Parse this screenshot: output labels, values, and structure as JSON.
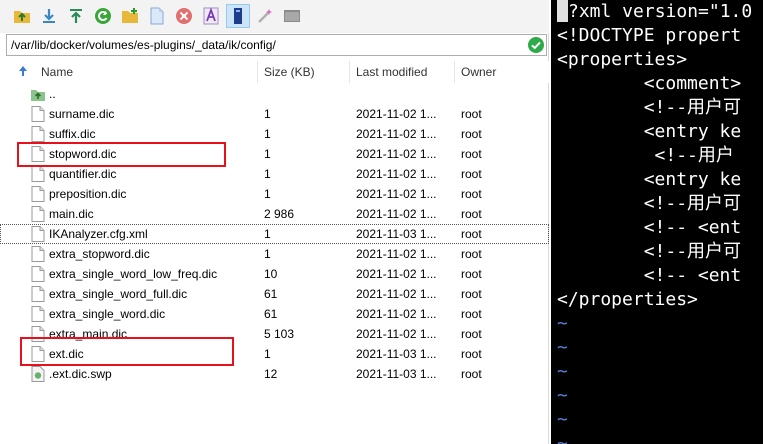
{
  "toolbar": {
    "buttons": [
      {
        "icon": "folder-up-icon"
      },
      {
        "icon": "download-icon"
      },
      {
        "icon": "upload-icon"
      },
      {
        "icon": "refresh-icon"
      },
      {
        "icon": "new-folder-icon"
      },
      {
        "icon": "new-file-icon"
      },
      {
        "icon": "delete-icon"
      },
      {
        "icon": "rename-icon"
      },
      {
        "icon": "properties-icon"
      },
      {
        "icon": "magic-wand-icon"
      },
      {
        "icon": "terminal-icon"
      }
    ]
  },
  "path_bar": {
    "path": "/var/lib/docker/volumes/es-plugins/_data/ik/config/"
  },
  "columns": {
    "name": "Name",
    "size": "Size (KB)",
    "modified": "Last modified",
    "owner": "Owner"
  },
  "files": [
    {
      "name": "..",
      "size": "",
      "modified": "",
      "owner": "",
      "icon": "parent-folder-icon"
    },
    {
      "name": "surname.dic",
      "size": "1",
      "modified": "2021-11-02 1...",
      "owner": "root",
      "icon": "file-icon"
    },
    {
      "name": "suffix.dic",
      "size": "1",
      "modified": "2021-11-02 1...",
      "owner": "root",
      "icon": "file-icon"
    },
    {
      "name": "stopword.dic",
      "size": "1",
      "modified": "2021-11-02 1...",
      "owner": "root",
      "icon": "file-icon"
    },
    {
      "name": "quantifier.dic",
      "size": "1",
      "modified": "2021-11-02 1...",
      "owner": "root",
      "icon": "file-icon"
    },
    {
      "name": "preposition.dic",
      "size": "1",
      "modified": "2021-11-02 1...",
      "owner": "root",
      "icon": "file-icon"
    },
    {
      "name": "main.dic",
      "size": "2 986",
      "modified": "2021-11-02 1...",
      "owner": "root",
      "icon": "file-icon"
    },
    {
      "name": "IKAnalyzer.cfg.xml",
      "size": "1",
      "modified": "2021-11-03 1...",
      "owner": "root",
      "icon": "file-icon"
    },
    {
      "name": "extra_stopword.dic",
      "size": "1",
      "modified": "2021-11-02 1...",
      "owner": "root",
      "icon": "file-icon"
    },
    {
      "name": "extra_single_word_low_freq.dic",
      "size": "10",
      "modified": "2021-11-02 1...",
      "owner": "root",
      "icon": "file-icon"
    },
    {
      "name": "extra_single_word_full.dic",
      "size": "61",
      "modified": "2021-11-02 1...",
      "owner": "root",
      "icon": "file-icon"
    },
    {
      "name": "extra_single_word.dic",
      "size": "61",
      "modified": "2021-11-02 1...",
      "owner": "root",
      "icon": "file-icon"
    },
    {
      "name": "extra_main.dic",
      "size": "5 103",
      "modified": "2021-11-02 1...",
      "owner": "root",
      "icon": "file-icon"
    },
    {
      "name": "ext.dic",
      "size": "1",
      "modified": "2021-11-03 1...",
      "owner": "root",
      "icon": "file-icon"
    },
    {
      "name": ".ext.dic.swp",
      "size": "12",
      "modified": "2021-11-03 1...",
      "owner": "root",
      "icon": "swap-file-icon"
    }
  ],
  "terminal": {
    "lines": [
      {
        "text": "?xml version=\"1.0",
        "color": "#ffffff"
      },
      {
        "text": "<!DOCTYPE propert",
        "color": "#ffffff"
      },
      {
        "text": "<properties>",
        "color": "#ffffff"
      },
      {
        "text": "        <comment>",
        "color": "#ffffff"
      },
      {
        "text": "        <!--用户可",
        "color": "#ffffff"
      },
      {
        "text": "        <entry ke",
        "color": "#ffffff"
      },
      {
        "text": "         <!--用户",
        "color": "#ffffff"
      },
      {
        "text": "        <entry ke",
        "color": "#ffffff"
      },
      {
        "text": "        <!--用户可",
        "color": "#ffffff"
      },
      {
        "text": "        <!-- <ent",
        "color": "#ffffff"
      },
      {
        "text": "        <!--用户可",
        "color": "#ffffff"
      },
      {
        "text": "        <!-- <ent",
        "color": "#ffffff"
      },
      {
        "text": "</properties>",
        "color": "#ffffff"
      },
      {
        "text": "~",
        "color": "#5a7fd8"
      },
      {
        "text": "~",
        "color": "#5a7fd8"
      },
      {
        "text": "~",
        "color": "#5a7fd8"
      },
      {
        "text": "~",
        "color": "#5a7fd8"
      },
      {
        "text": "~",
        "color": "#5a7fd8"
      },
      {
        "text": "~",
        "color": "#5a7fd8"
      }
    ]
  },
  "colors": {
    "highlight_box": "#e8101a",
    "selection": "#cce4f7",
    "terminal_bg": "#000000",
    "tilde": "#5a7fd8"
  }
}
